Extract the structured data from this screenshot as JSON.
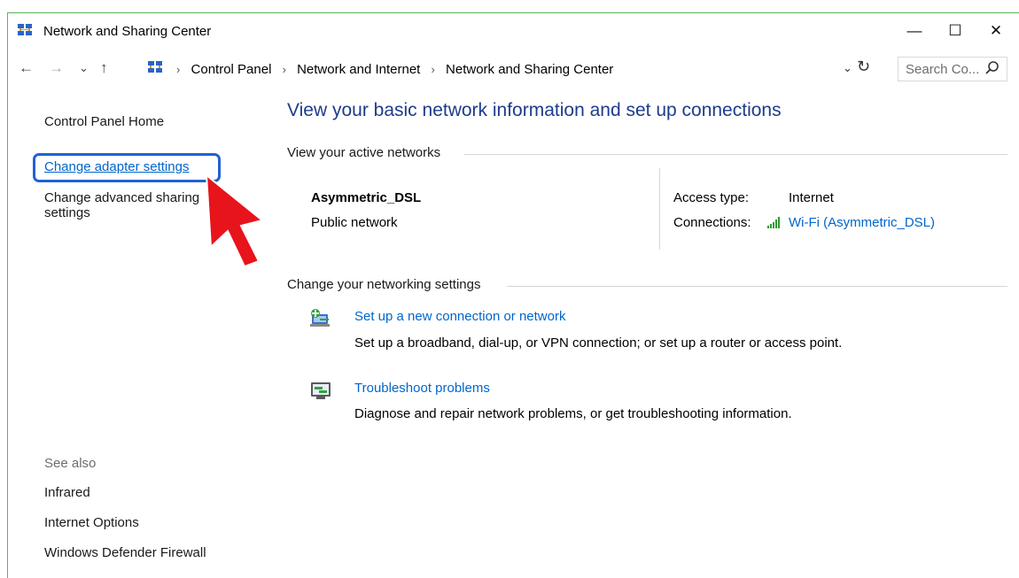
{
  "window": {
    "title": "Network and Sharing Center",
    "controls": {
      "minimize": "—",
      "maximize": "☐",
      "close": "✕"
    }
  },
  "address": {
    "back": "←",
    "forward": "→",
    "recent": "⌄",
    "up": "↑",
    "breadcrumbs": [
      "Control Panel",
      "Network and Internet",
      "Network and Sharing Center"
    ],
    "separator": "›",
    "dropdown": "⌄",
    "refresh": "↻",
    "search_placeholder": "Search Co..."
  },
  "sidebar": {
    "home": "Control Panel Home",
    "change_adapter": "Change adapter settings",
    "change_advanced_line1": "Change advanced sharing",
    "change_advanced_line2": "settings",
    "see_also": "See also",
    "see_also_items": [
      "Infrared",
      "Internet Options",
      "Windows Defender Firewall"
    ]
  },
  "main": {
    "title": "View your basic network information and set up connections",
    "active_networks_header": "View your active networks",
    "network_name": "Asymmetric_DSL",
    "network_type": "Public network",
    "access_type_label": "Access type:",
    "access_type_value": "Internet",
    "connections_label": "Connections:",
    "connections_value": "Wi-Fi (Asymmetric_DSL)",
    "change_settings_header": "Change your networking settings",
    "actions": [
      {
        "title": "Set up a new connection or network",
        "description": "Set up a broadband, dial-up, or VPN connection; or set up a router or access point."
      },
      {
        "title": "Troubleshoot problems",
        "description": "Diagnose and repair network problems, or get troubleshooting information."
      }
    ]
  },
  "colors": {
    "title_blue": "#1e3c8c",
    "link_blue": "#0066cc",
    "highlight_blue": "#1f62d6",
    "arrow_red": "#e8141c"
  }
}
